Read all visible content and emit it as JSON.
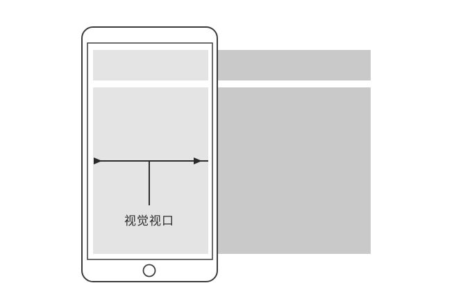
{
  "diagram": {
    "caption": "视觉视口",
    "colors": {
      "background": "#ffffff",
      "layout_viewport": "#c9c9c9",
      "visual_viewport": "#e4e4e4",
      "outline": "#3a3a3a"
    }
  }
}
